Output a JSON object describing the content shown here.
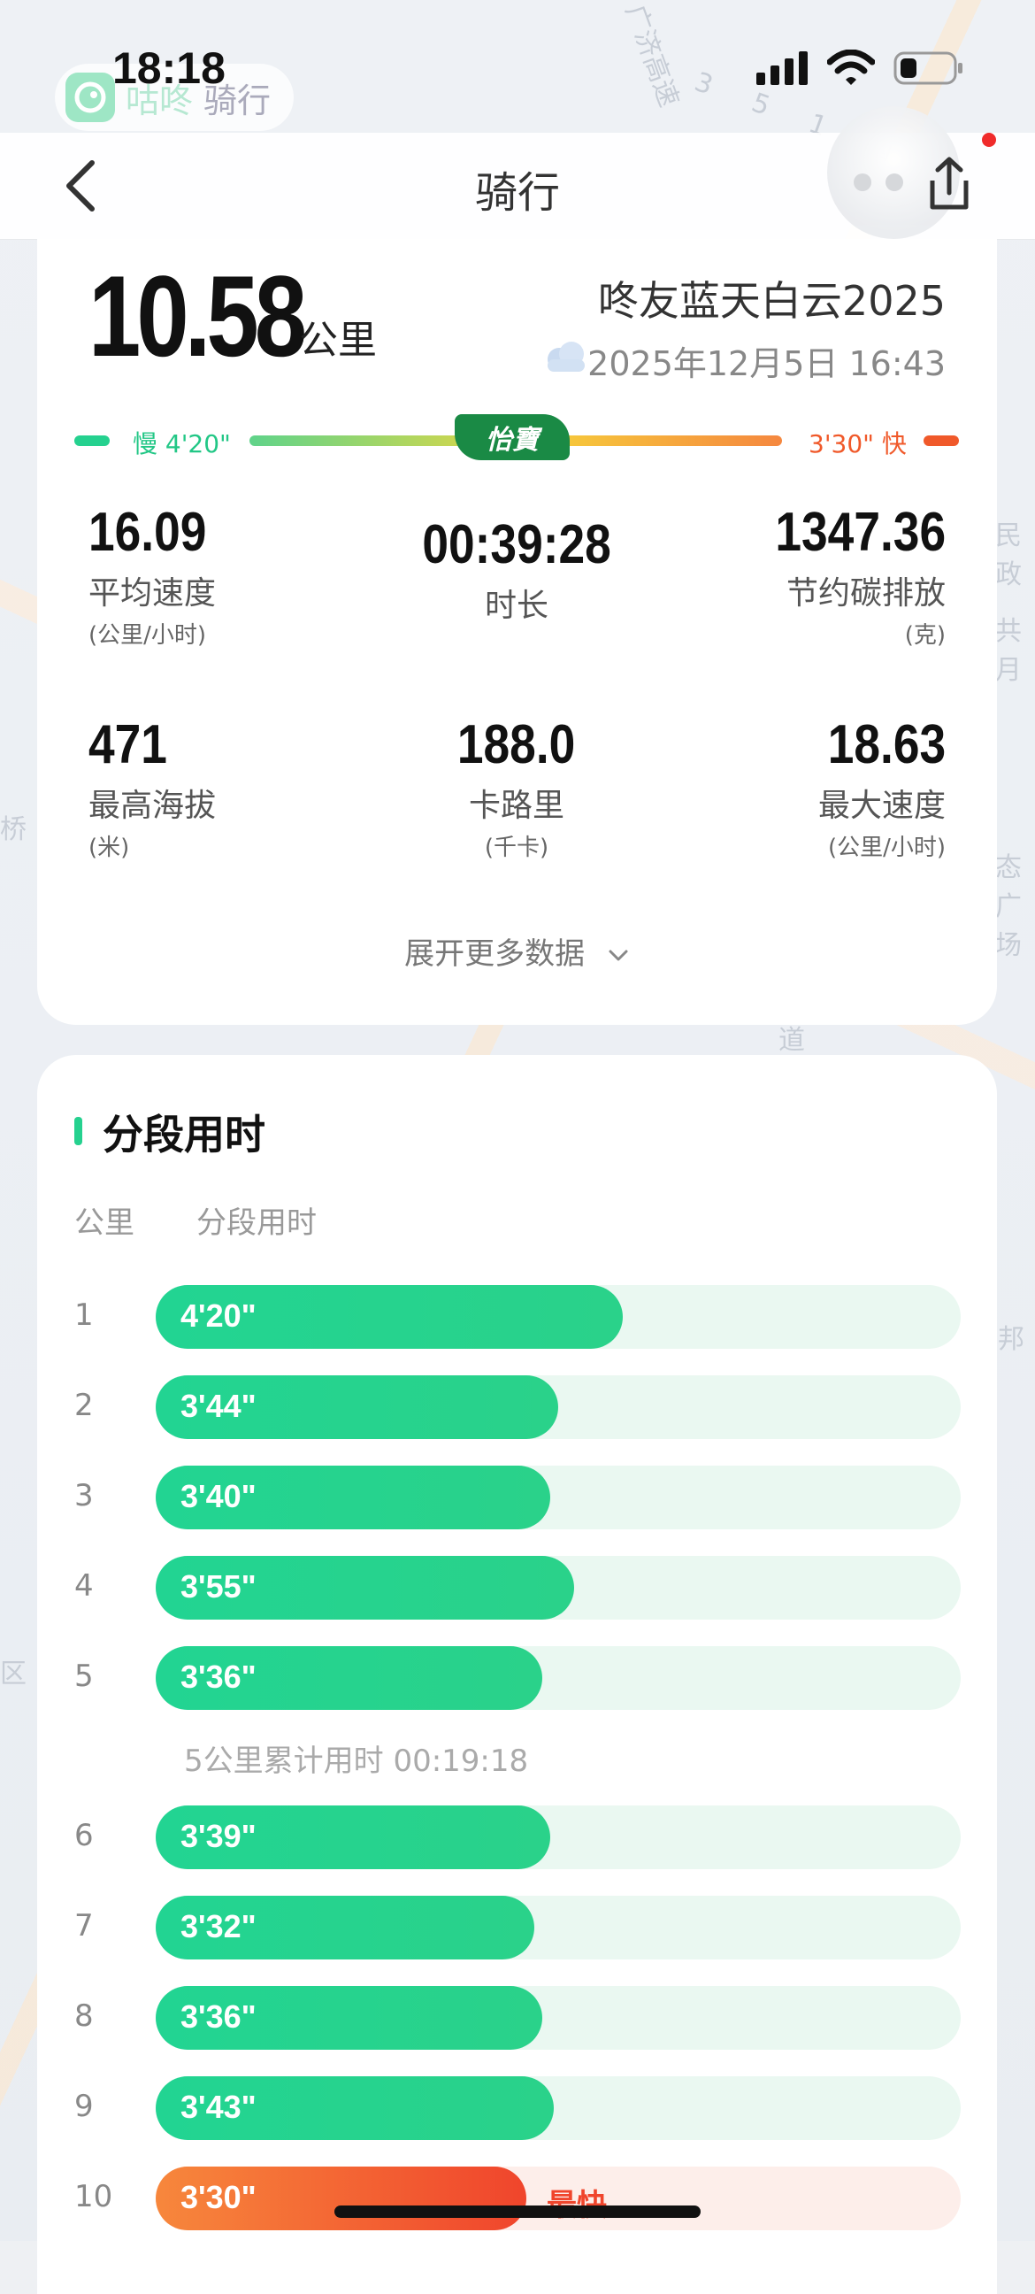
{
  "status_bar": {
    "time": "18:18"
  },
  "app_pill": {
    "name": "咕咚",
    "sub": "骑行"
  },
  "nav": {
    "title": "骑行"
  },
  "summary": {
    "distance": "10.58",
    "distance_unit": "公里",
    "ride_name": "咚友蓝天白云2025",
    "date": "2025年12月5日 16:43"
  },
  "pace_scale": {
    "slow": "慢 4'20\"",
    "fast": "3'30\" 快",
    "brand": "怡寶"
  },
  "stats": [
    {
      "value": "16.09",
      "label": "平均速度",
      "unit": "(公里/小时)"
    },
    {
      "value": "00:39:28",
      "label": "时长",
      "unit": ""
    },
    {
      "value": "1347.36",
      "label": "节约碳排放",
      "unit": "(克)"
    },
    {
      "value": "471",
      "label": "最高海拔",
      "unit": "(米)"
    },
    {
      "value": "188.0",
      "label": "卡路里",
      "unit": "(千卡)"
    },
    {
      "value": "18.63",
      "label": "最大速度",
      "unit": "(公里/小时)"
    }
  ],
  "expand_label": "展开更多数据",
  "splits": {
    "title": "分段用时",
    "col_km": "公里",
    "col_time": "分段用时",
    "cumulative_5km": "5公里累计用时 00:19:18",
    "fastest_tag": "最快",
    "rows": [
      {
        "km": "1",
        "time": "4'20\"",
        "fraction": 0.58
      },
      {
        "km": "2",
        "time": "3'44\"",
        "fraction": 0.5
      },
      {
        "km": "3",
        "time": "3'40\"",
        "fraction": 0.49
      },
      {
        "km": "4",
        "time": "3'55\"",
        "fraction": 0.52
      },
      {
        "km": "5",
        "time": "3'36\"",
        "fraction": 0.48
      },
      {
        "km": "6",
        "time": "3'39\"",
        "fraction": 0.49
      },
      {
        "km": "7",
        "time": "3'32\"",
        "fraction": 0.47
      },
      {
        "km": "8",
        "time": "3'36\"",
        "fraction": 0.48
      },
      {
        "km": "9",
        "time": "3'43\"",
        "fraction": 0.495
      },
      {
        "km": "10",
        "time": "3'30\"",
        "fraction": 0.46,
        "fastest": true
      }
    ]
  },
  "colors": {
    "green": "#25d18f",
    "orange": "#f0592a"
  },
  "map_labels": [
    "广济高速",
    "3 5 1 国",
    "民政",
    "共月",
    "桥",
    "态广场",
    "邦",
    "区",
    "道"
  ]
}
